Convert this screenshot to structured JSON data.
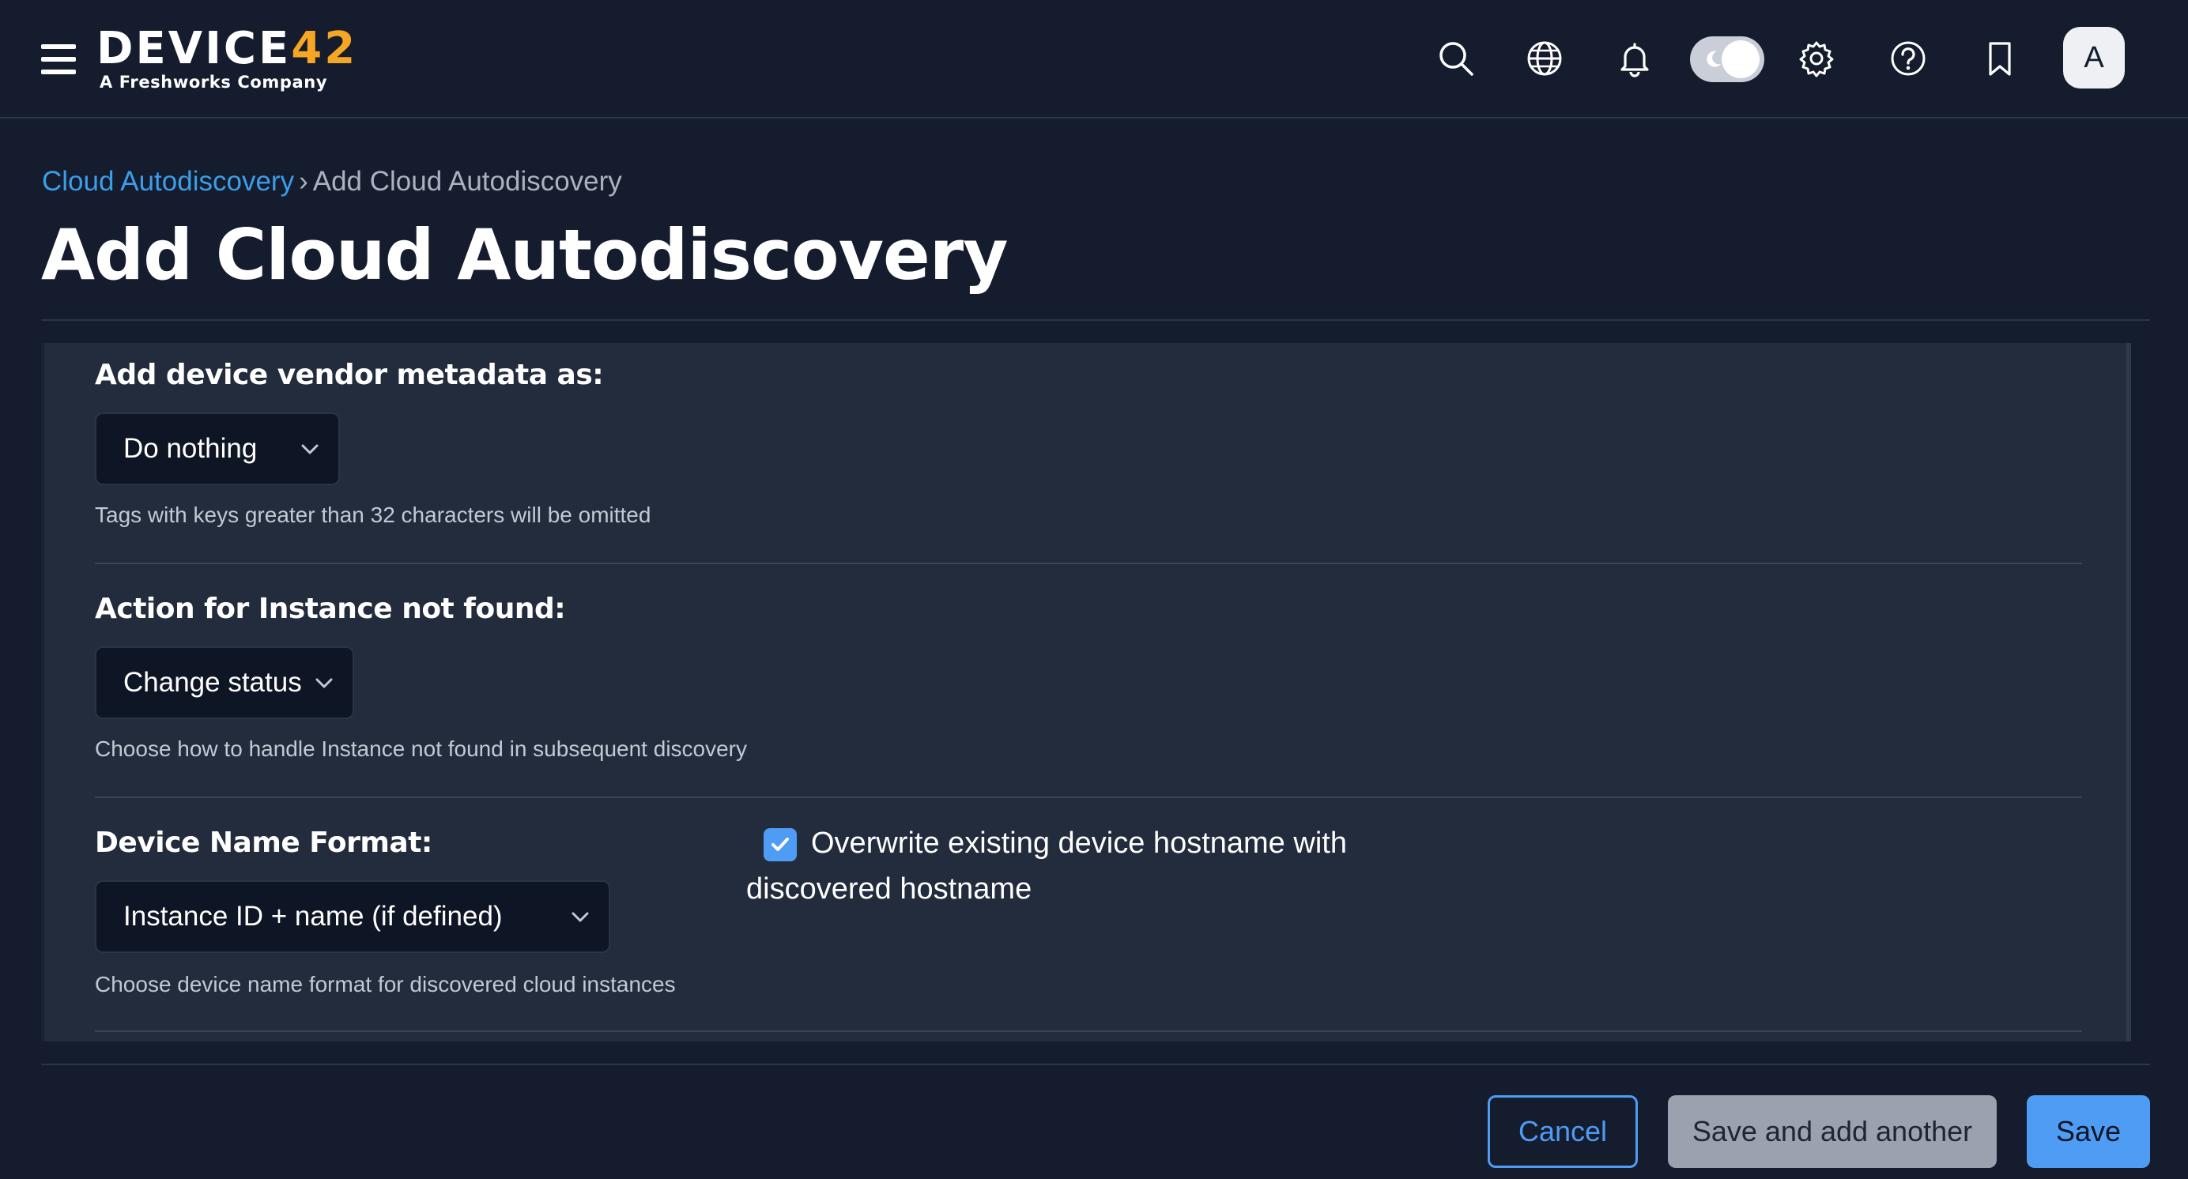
{
  "header": {
    "logo_text_main": "DEVICE",
    "logo_text_accent": "42",
    "logo_subtitle": "A Freshworks Company",
    "avatar_initial": "A"
  },
  "breadcrumb": {
    "parent": "Cloud Autodiscovery",
    "separator": "›",
    "current": "Add Cloud Autodiscovery"
  },
  "page": {
    "title": "Add Cloud Autodiscovery"
  },
  "form": {
    "vendor_metadata": {
      "label": "Add device vendor metadata as:",
      "value": "Do nothing",
      "helper": "Tags with keys greater than 32 characters will be omitted"
    },
    "instance_not_found": {
      "label": "Action for Instance not found:",
      "value": "Change status",
      "helper": "Choose how to handle Instance not found in subsequent discovery"
    },
    "device_name_format": {
      "label": "Device Name Format:",
      "value": "Instance ID + name (if defined)",
      "helper": "Choose device name format for discovered cloud instances"
    },
    "overwrite_hostname": {
      "label": "Overwrite existing device hostname with discovered hostname",
      "checked": true
    }
  },
  "footer": {
    "cancel_label": "Cancel",
    "save_another_label": "Save and add another",
    "save_label": "Save"
  },
  "colors": {
    "background": "#141c2e",
    "panel": "#222c3d",
    "accent_blue": "#4f9cf5",
    "link_blue": "#3b9ee8",
    "logo_accent": "#f5a623"
  }
}
